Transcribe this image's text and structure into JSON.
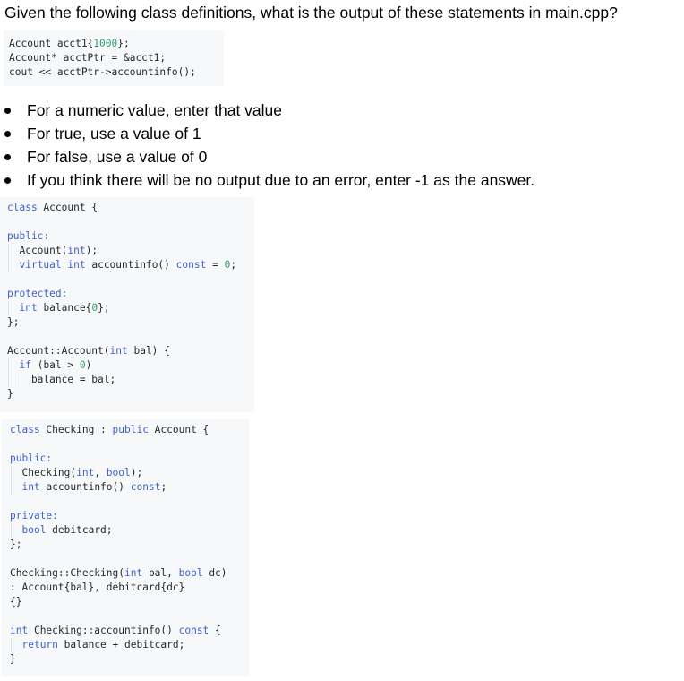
{
  "question": "Given the following class definitions, what is the output of these statements in main.cpp?",
  "main_snippet": [
    [
      {
        "t": "Account acct1{",
        "c": "plain"
      },
      {
        "t": "1000",
        "c": "num"
      },
      {
        "t": "};",
        "c": "plain"
      }
    ],
    [
      {
        "t": "Account* acctPtr = &acct1;",
        "c": "plain"
      }
    ],
    [
      {
        "t": "cout << acctPtr->accountinfo();",
        "c": "plain"
      }
    ]
  ],
  "instructions": [
    "For a numeric value, enter that value",
    "For true, use a value of 1",
    "For false, use a value of 0",
    "If you think there will be no output due to an error, enter -1 as the answer."
  ],
  "account_code": [
    [
      {
        "t": "class",
        "c": "kw"
      },
      {
        "t": " Account {",
        "c": "plain"
      }
    ],
    [],
    [
      {
        "t": "public:",
        "c": "kw"
      }
    ],
    [
      {
        "t": "  Account(",
        "c": "plain"
      },
      {
        "t": "int",
        "c": "kw"
      },
      {
        "t": ");",
        "c": "plain"
      }
    ],
    [
      {
        "t": "  ",
        "c": "plain"
      },
      {
        "t": "virtual",
        "c": "kw"
      },
      {
        "t": " ",
        "c": "plain"
      },
      {
        "t": "int",
        "c": "kw"
      },
      {
        "t": " accountinfo() ",
        "c": "plain"
      },
      {
        "t": "const",
        "c": "kw"
      },
      {
        "t": " = ",
        "c": "plain"
      },
      {
        "t": "0",
        "c": "num"
      },
      {
        "t": ";",
        "c": "plain"
      }
    ],
    [],
    [
      {
        "t": "protected:",
        "c": "kw"
      }
    ],
    [
      {
        "t": "  ",
        "c": "plain"
      },
      {
        "t": "int",
        "c": "kw"
      },
      {
        "t": " balance{",
        "c": "plain"
      },
      {
        "t": "0",
        "c": "num"
      },
      {
        "t": "};",
        "c": "plain"
      }
    ],
    [
      {
        "t": "};",
        "c": "plain"
      }
    ],
    [],
    [
      {
        "t": "Account::Account(",
        "c": "plain"
      },
      {
        "t": "int",
        "c": "kw"
      },
      {
        "t": " bal) {",
        "c": "plain"
      }
    ],
    [
      {
        "t": "  ",
        "c": "plain"
      },
      {
        "t": "if",
        "c": "kw"
      },
      {
        "t": " (bal > ",
        "c": "plain"
      },
      {
        "t": "0",
        "c": "num"
      },
      {
        "t": ")",
        "c": "plain"
      }
    ],
    [
      {
        "t": "    balance = bal;",
        "c": "plain"
      }
    ],
    [
      {
        "t": "}",
        "c": "plain"
      }
    ]
  ],
  "checking_code": [
    [
      {
        "t": "class",
        "c": "kw"
      },
      {
        "t": " Checking : ",
        "c": "plain"
      },
      {
        "t": "public",
        "c": "kw"
      },
      {
        "t": " Account {",
        "c": "plain"
      }
    ],
    [],
    [
      {
        "t": "public:",
        "c": "kw"
      }
    ],
    [
      {
        "t": "  Checking(",
        "c": "plain"
      },
      {
        "t": "int",
        "c": "kw"
      },
      {
        "t": ", ",
        "c": "plain"
      },
      {
        "t": "bool",
        "c": "kw"
      },
      {
        "t": ");",
        "c": "plain"
      }
    ],
    [
      {
        "t": "  ",
        "c": "plain"
      },
      {
        "t": "int",
        "c": "kw"
      },
      {
        "t": " accountinfo() ",
        "c": "plain"
      },
      {
        "t": "const",
        "c": "kw"
      },
      {
        "t": ";",
        "c": "plain"
      }
    ],
    [],
    [
      {
        "t": "private:",
        "c": "kw"
      }
    ],
    [
      {
        "t": "  ",
        "c": "plain"
      },
      {
        "t": "bool",
        "c": "kw"
      },
      {
        "t": " debitcard;",
        "c": "plain"
      }
    ],
    [
      {
        "t": "};",
        "c": "plain"
      }
    ],
    [],
    [
      {
        "t": "Checking::Checking(",
        "c": "plain"
      },
      {
        "t": "int",
        "c": "kw"
      },
      {
        "t": " bal, ",
        "c": "plain"
      },
      {
        "t": "bool",
        "c": "kw"
      },
      {
        "t": " dc)",
        "c": "plain"
      }
    ],
    [
      {
        "t": ": Account{bal}, debitcard{dc}",
        "c": "plain"
      }
    ],
    [
      {
        "t": "{}",
        "c": "plain"
      }
    ],
    [],
    [
      {
        "t": "int",
        "c": "kw"
      },
      {
        "t": " Checking::accountinfo() ",
        "c": "plain"
      },
      {
        "t": "const",
        "c": "kw"
      },
      {
        "t": " {",
        "c": "plain"
      }
    ],
    [
      {
        "t": "  ",
        "c": "plain"
      },
      {
        "t": "return",
        "c": "kw"
      },
      {
        "t": " balance + debitcard;",
        "c": "plain"
      }
    ],
    [
      {
        "t": "}",
        "c": "plain"
      }
    ]
  ],
  "colors": {
    "keyword": "#3f5fd1",
    "number": "#2e9e6b",
    "code_text": "#24292e",
    "code_background": "#f6f8fa"
  }
}
